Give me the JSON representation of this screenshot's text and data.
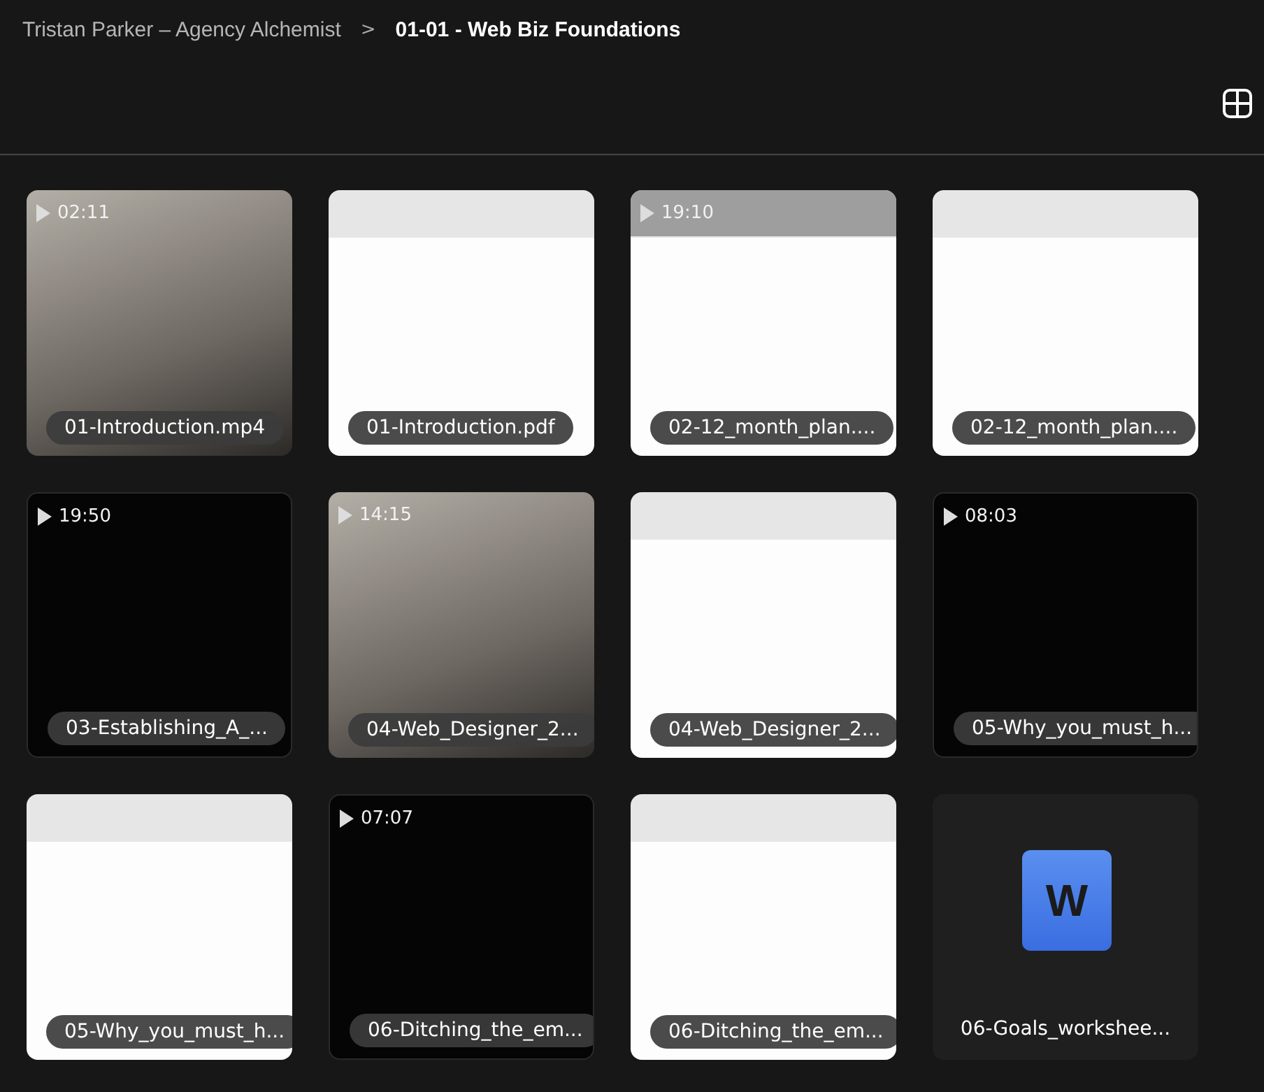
{
  "breadcrumb": {
    "parent": "Tristan Parker – Agency Alchemist",
    "separator": ">",
    "current": "01-01 - Web Biz Foundations"
  },
  "files": [
    {
      "name": "01-Introduction.mp4",
      "kind": "video",
      "preview": {
        "kind": "photo"
      },
      "duration": "02:11"
    },
    {
      "name": "01-Introduction.pdf",
      "kind": "document",
      "preview": {
        "kind": "light"
      }
    },
    {
      "name": "02-12_month_plan....",
      "kind": "video",
      "preview": {
        "kind": "light"
      },
      "duration": "19:10"
    },
    {
      "name": "02-12_month_plan....",
      "kind": "document",
      "preview": {
        "kind": "light"
      }
    },
    {
      "name": "03-Establishing_A_...",
      "kind": "video",
      "preview": {
        "kind": "dark"
      },
      "duration": "19:50"
    },
    {
      "name": "04-Web_Designer_2...",
      "kind": "video",
      "preview": {
        "kind": "photo"
      },
      "duration": "14:15"
    },
    {
      "name": "04-Web_Designer_2...",
      "kind": "document",
      "preview": {
        "kind": "light"
      }
    },
    {
      "name": "05-Why_you_must_h...",
      "kind": "video",
      "preview": {
        "kind": "dark"
      },
      "duration": "08:03"
    },
    {
      "name": "05-Why_you_must_h...",
      "kind": "document",
      "preview": {
        "kind": "light"
      }
    },
    {
      "name": "06-Ditching_the_em...",
      "kind": "video",
      "preview": {
        "kind": "dark"
      },
      "duration": "07:07"
    },
    {
      "name": "06-Ditching_the_em...",
      "kind": "document",
      "preview": {
        "kind": "light"
      }
    },
    {
      "name": "06-Goals_workshee...",
      "kind": "word",
      "icon_letter": "W"
    }
  ]
}
